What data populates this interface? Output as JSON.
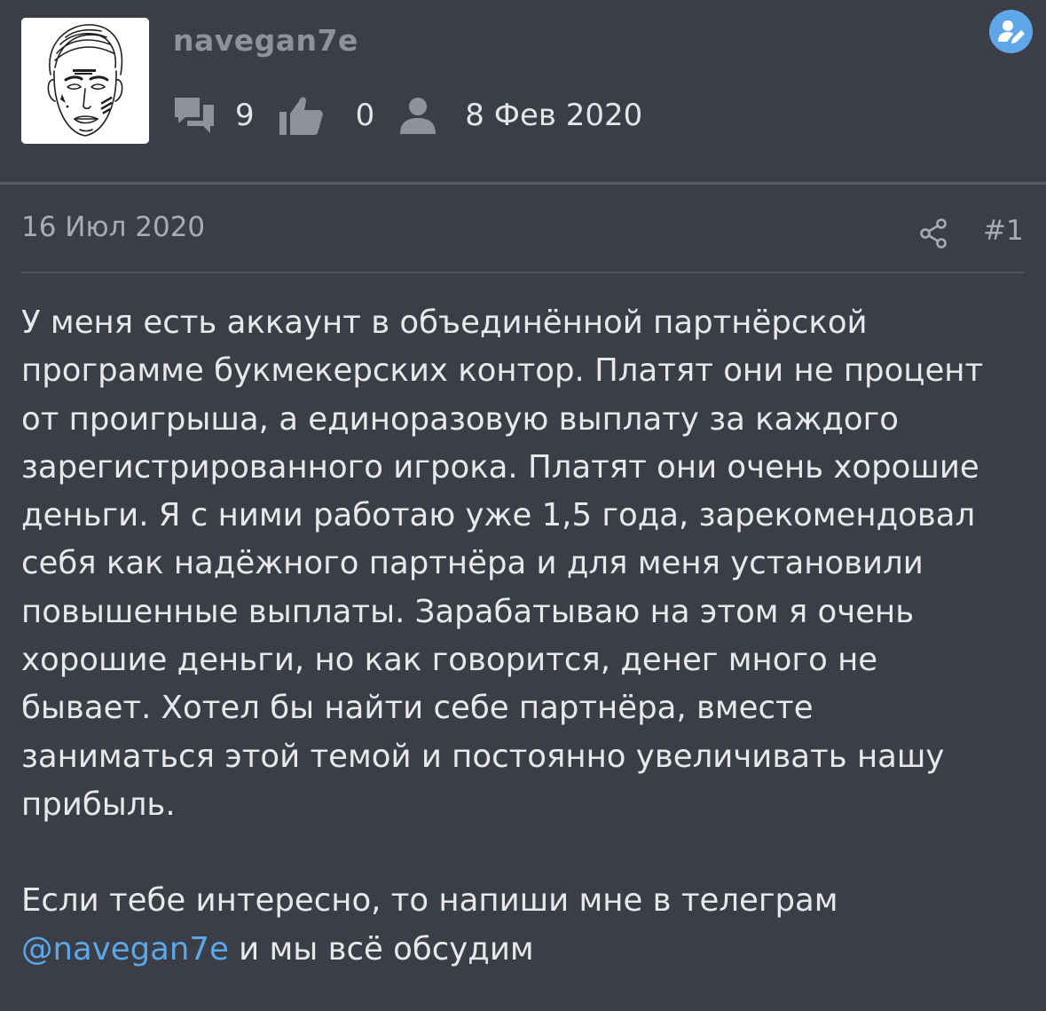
{
  "author": {
    "username": "navegan7e",
    "stats": {
      "messages": "9",
      "reactions": "0",
      "joined": "8 Фев 2020"
    }
  },
  "post": {
    "date": "16 Июл 2020",
    "number": "#1",
    "paragraph1": "У меня есть аккаунт в объединённой партнёрской\nпрограмме букмекерских контор. Платят они не процент\nот проигрыша, а единоразовую выплату за каждого\nзарегистрированного игрока. Платят они очень хорошие\nденьги. Я с ними работаю уже 1,5 года, зарекомендовал\nсебя как надёжного партнёра и для меня установили\nповышенные выплаты. Зарабатываю на этом я очень\nхорошие деньги, но как говорится, денег много не\nбывает. Хотел бы найти себе партнёра, вместе\nзаниматься этой темой и постоянно увеличивать нашу\nприбыль.",
    "paragraph2_start": "Если тебе интересно, то напиши мне в телеграм",
    "mention": "@navegan7e",
    "paragraph2_end": " и мы всё обсудим"
  },
  "colors": {
    "background": "#3b3e46",
    "text": "#e7e8ea",
    "muted": "#a9acb4",
    "username": "#8e929c",
    "accent": "#5aa8ea"
  },
  "icons": [
    "messages-icon",
    "thumbs-up-icon",
    "user-icon",
    "edit-profile-icon",
    "share-icon"
  ]
}
